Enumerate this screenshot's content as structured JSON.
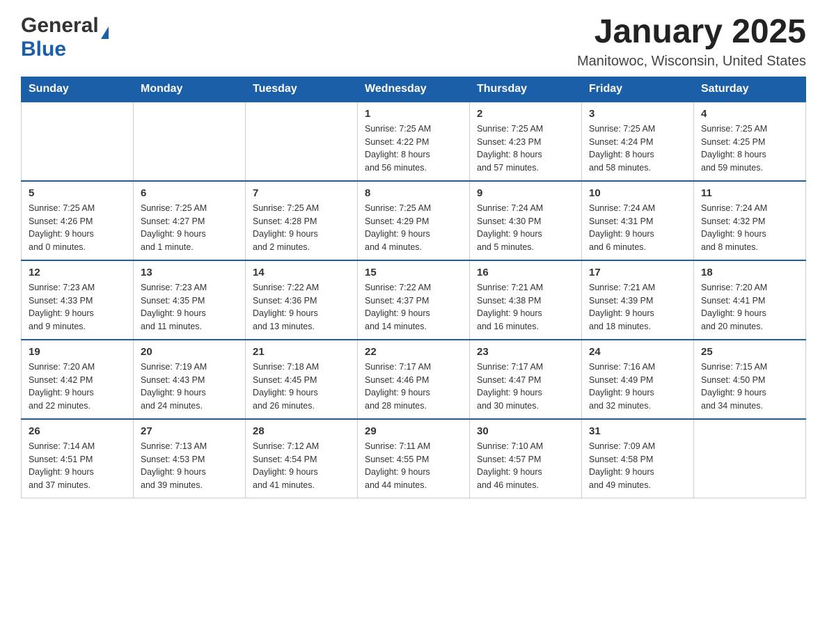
{
  "header": {
    "logo_general": "General",
    "logo_blue": "Blue",
    "title": "January 2025",
    "subtitle": "Manitowoc, Wisconsin, United States"
  },
  "calendar": {
    "days_of_week": [
      "Sunday",
      "Monday",
      "Tuesday",
      "Wednesday",
      "Thursday",
      "Friday",
      "Saturday"
    ],
    "weeks": [
      [
        {
          "day": "",
          "info": ""
        },
        {
          "day": "",
          "info": ""
        },
        {
          "day": "",
          "info": ""
        },
        {
          "day": "1",
          "info": "Sunrise: 7:25 AM\nSunset: 4:22 PM\nDaylight: 8 hours\nand 56 minutes."
        },
        {
          "day": "2",
          "info": "Sunrise: 7:25 AM\nSunset: 4:23 PM\nDaylight: 8 hours\nand 57 minutes."
        },
        {
          "day": "3",
          "info": "Sunrise: 7:25 AM\nSunset: 4:24 PM\nDaylight: 8 hours\nand 58 minutes."
        },
        {
          "day": "4",
          "info": "Sunrise: 7:25 AM\nSunset: 4:25 PM\nDaylight: 8 hours\nand 59 minutes."
        }
      ],
      [
        {
          "day": "5",
          "info": "Sunrise: 7:25 AM\nSunset: 4:26 PM\nDaylight: 9 hours\nand 0 minutes."
        },
        {
          "day": "6",
          "info": "Sunrise: 7:25 AM\nSunset: 4:27 PM\nDaylight: 9 hours\nand 1 minute."
        },
        {
          "day": "7",
          "info": "Sunrise: 7:25 AM\nSunset: 4:28 PM\nDaylight: 9 hours\nand 2 minutes."
        },
        {
          "day": "8",
          "info": "Sunrise: 7:25 AM\nSunset: 4:29 PM\nDaylight: 9 hours\nand 4 minutes."
        },
        {
          "day": "9",
          "info": "Sunrise: 7:24 AM\nSunset: 4:30 PM\nDaylight: 9 hours\nand 5 minutes."
        },
        {
          "day": "10",
          "info": "Sunrise: 7:24 AM\nSunset: 4:31 PM\nDaylight: 9 hours\nand 6 minutes."
        },
        {
          "day": "11",
          "info": "Sunrise: 7:24 AM\nSunset: 4:32 PM\nDaylight: 9 hours\nand 8 minutes."
        }
      ],
      [
        {
          "day": "12",
          "info": "Sunrise: 7:23 AM\nSunset: 4:33 PM\nDaylight: 9 hours\nand 9 minutes."
        },
        {
          "day": "13",
          "info": "Sunrise: 7:23 AM\nSunset: 4:35 PM\nDaylight: 9 hours\nand 11 minutes."
        },
        {
          "day": "14",
          "info": "Sunrise: 7:22 AM\nSunset: 4:36 PM\nDaylight: 9 hours\nand 13 minutes."
        },
        {
          "day": "15",
          "info": "Sunrise: 7:22 AM\nSunset: 4:37 PM\nDaylight: 9 hours\nand 14 minutes."
        },
        {
          "day": "16",
          "info": "Sunrise: 7:21 AM\nSunset: 4:38 PM\nDaylight: 9 hours\nand 16 minutes."
        },
        {
          "day": "17",
          "info": "Sunrise: 7:21 AM\nSunset: 4:39 PM\nDaylight: 9 hours\nand 18 minutes."
        },
        {
          "day": "18",
          "info": "Sunrise: 7:20 AM\nSunset: 4:41 PM\nDaylight: 9 hours\nand 20 minutes."
        }
      ],
      [
        {
          "day": "19",
          "info": "Sunrise: 7:20 AM\nSunset: 4:42 PM\nDaylight: 9 hours\nand 22 minutes."
        },
        {
          "day": "20",
          "info": "Sunrise: 7:19 AM\nSunset: 4:43 PM\nDaylight: 9 hours\nand 24 minutes."
        },
        {
          "day": "21",
          "info": "Sunrise: 7:18 AM\nSunset: 4:45 PM\nDaylight: 9 hours\nand 26 minutes."
        },
        {
          "day": "22",
          "info": "Sunrise: 7:17 AM\nSunset: 4:46 PM\nDaylight: 9 hours\nand 28 minutes."
        },
        {
          "day": "23",
          "info": "Sunrise: 7:17 AM\nSunset: 4:47 PM\nDaylight: 9 hours\nand 30 minutes."
        },
        {
          "day": "24",
          "info": "Sunrise: 7:16 AM\nSunset: 4:49 PM\nDaylight: 9 hours\nand 32 minutes."
        },
        {
          "day": "25",
          "info": "Sunrise: 7:15 AM\nSunset: 4:50 PM\nDaylight: 9 hours\nand 34 minutes."
        }
      ],
      [
        {
          "day": "26",
          "info": "Sunrise: 7:14 AM\nSunset: 4:51 PM\nDaylight: 9 hours\nand 37 minutes."
        },
        {
          "day": "27",
          "info": "Sunrise: 7:13 AM\nSunset: 4:53 PM\nDaylight: 9 hours\nand 39 minutes."
        },
        {
          "day": "28",
          "info": "Sunrise: 7:12 AM\nSunset: 4:54 PM\nDaylight: 9 hours\nand 41 minutes."
        },
        {
          "day": "29",
          "info": "Sunrise: 7:11 AM\nSunset: 4:55 PM\nDaylight: 9 hours\nand 44 minutes."
        },
        {
          "day": "30",
          "info": "Sunrise: 7:10 AM\nSunset: 4:57 PM\nDaylight: 9 hours\nand 46 minutes."
        },
        {
          "day": "31",
          "info": "Sunrise: 7:09 AM\nSunset: 4:58 PM\nDaylight: 9 hours\nand 49 minutes."
        },
        {
          "day": "",
          "info": ""
        }
      ]
    ]
  }
}
